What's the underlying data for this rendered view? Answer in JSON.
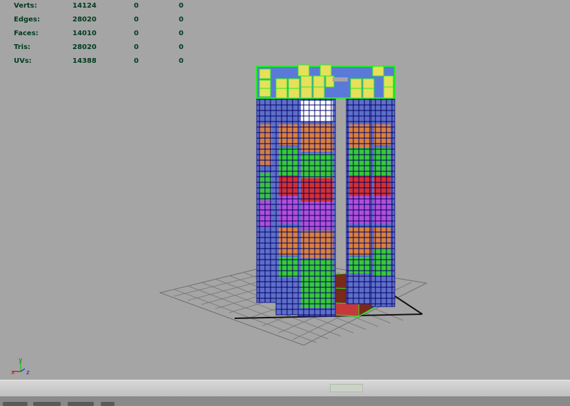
{
  "hud": {
    "rows": [
      {
        "label": "Verts:",
        "v1": "14124",
        "v2": "0",
        "v3": "0"
      },
      {
        "label": "Edges:",
        "v1": "28020",
        "v2": "0",
        "v3": "0"
      },
      {
        "label": "Faces:",
        "v1": "14010",
        "v2": "0",
        "v3": "0"
      },
      {
        "label": "Tris:",
        "v1": "28020",
        "v2": "0",
        "v3": "0"
      },
      {
        "label": "UVs:",
        "v1": "14388",
        "v2": "0",
        "v3": "0"
      }
    ]
  },
  "axis": {
    "x": "x",
    "y": "y",
    "z": "z"
  },
  "colors": {
    "viewport_bg": "#a5a5a5",
    "hud_text": "#003b1f",
    "wire": "#1a1a8c",
    "selected_wire": "#22ee22",
    "grid": "#7a7a7a"
  }
}
